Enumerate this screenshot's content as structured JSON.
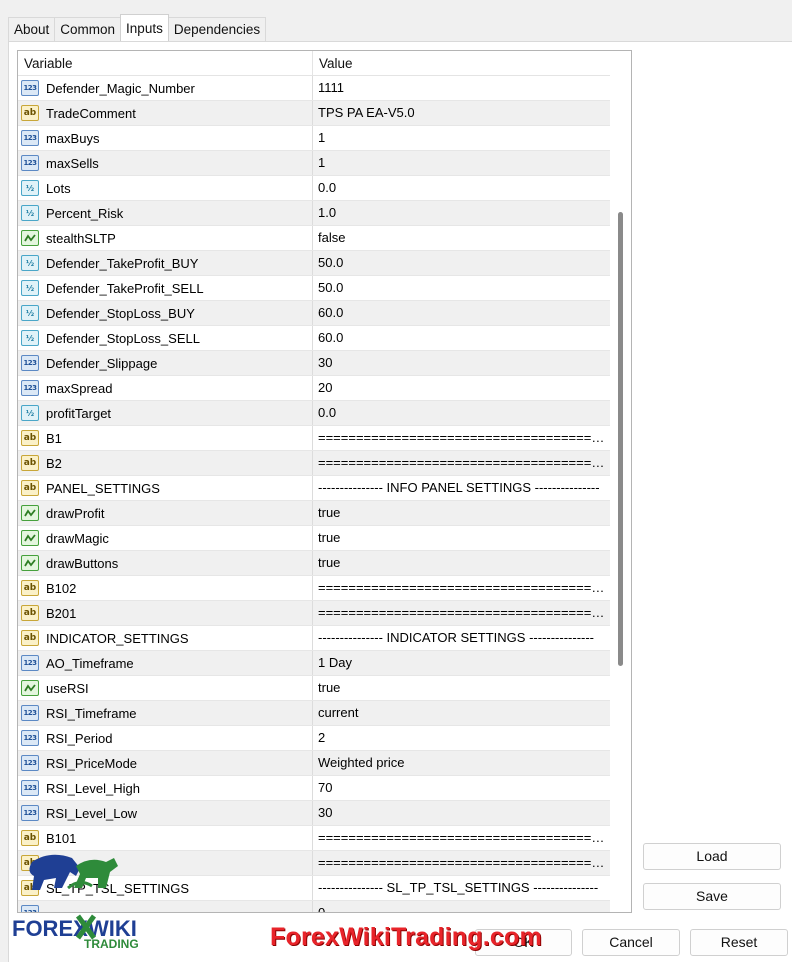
{
  "tabs": [
    "About",
    "Common",
    "Inputs",
    "Dependencies"
  ],
  "active_tab": "Inputs",
  "grid": {
    "columns": [
      "Variable",
      "Value"
    ],
    "rows": [
      {
        "type": "int",
        "name": "Defender_Magic_Number",
        "value": "1111"
      },
      {
        "type": "str",
        "name": "TradeComment",
        "value": "TPS PA EA-V5.0"
      },
      {
        "type": "int",
        "name": "maxBuys",
        "value": "1"
      },
      {
        "type": "int",
        "name": "maxSells",
        "value": "1"
      },
      {
        "type": "dbl",
        "name": "Lots",
        "value": "0.0"
      },
      {
        "type": "dbl",
        "name": "Percent_Risk",
        "value": "1.0"
      },
      {
        "type": "bool",
        "name": "stealthSLTP",
        "value": "false"
      },
      {
        "type": "dbl",
        "name": "Defender_TakeProfit_BUY",
        "value": "50.0"
      },
      {
        "type": "dbl",
        "name": "Defender_TakeProfit_SELL",
        "value": "50.0"
      },
      {
        "type": "dbl",
        "name": "Defender_StopLoss_BUY",
        "value": "60.0"
      },
      {
        "type": "dbl",
        "name": "Defender_StopLoss_SELL",
        "value": "60.0"
      },
      {
        "type": "int",
        "name": "Defender_Slippage",
        "value": "30"
      },
      {
        "type": "int",
        "name": "maxSpread",
        "value": "20"
      },
      {
        "type": "dbl",
        "name": "profitTarget",
        "value": "0.0"
      },
      {
        "type": "str",
        "name": "B1",
        "value": "========================================..."
      },
      {
        "type": "str",
        "name": "B2",
        "value": "========================================..."
      },
      {
        "type": "str",
        "name": "PANEL_SETTINGS",
        "value": "--------------- INFO PANEL SETTINGS ---------------"
      },
      {
        "type": "bool",
        "name": "drawProfit",
        "value": "true"
      },
      {
        "type": "bool",
        "name": "drawMagic",
        "value": "true"
      },
      {
        "type": "bool",
        "name": "drawButtons",
        "value": "true"
      },
      {
        "type": "str",
        "name": "B102",
        "value": "========================================..."
      },
      {
        "type": "str",
        "name": "B201",
        "value": "========================================..."
      },
      {
        "type": "str",
        "name": "INDICATOR_SETTINGS",
        "value": "--------------- INDICATOR SETTINGS ---------------"
      },
      {
        "type": "int",
        "name": "AO_Timeframe",
        "value": "1 Day"
      },
      {
        "type": "bool",
        "name": "useRSI",
        "value": "true"
      },
      {
        "type": "int",
        "name": "RSI_Timeframe",
        "value": "current"
      },
      {
        "type": "int",
        "name": "RSI_Period",
        "value": "2"
      },
      {
        "type": "int",
        "name": "RSI_PriceMode",
        "value": "Weighted price"
      },
      {
        "type": "int",
        "name": "RSI_Level_High",
        "value": "70"
      },
      {
        "type": "int",
        "name": "RSI_Level_Low",
        "value": "30"
      },
      {
        "type": "str",
        "name": "B101",
        "value": "========================================..."
      },
      {
        "type": "str",
        "name": "",
        "value": "========================================..."
      },
      {
        "type": "str",
        "name": "SL_TP_TSL_SETTINGS",
        "value": "--------------- SL_TP_TSL_SETTINGS ---------------"
      },
      {
        "type": "int",
        "name": "",
        "value": "0"
      }
    ]
  },
  "buttons": {
    "load": "Load",
    "save": "Save",
    "ok": "OK",
    "cancel": "Cancel",
    "reset": "Reset"
  },
  "icon_labels": {
    "int": "123",
    "dbl": "½",
    "str": "ab"
  },
  "watermark": {
    "logo_top": "FOREX",
    "logo_wiki": "WIKI",
    "logo_sub": "TRADING",
    "brand": "ForexWikiTrading.com"
  }
}
